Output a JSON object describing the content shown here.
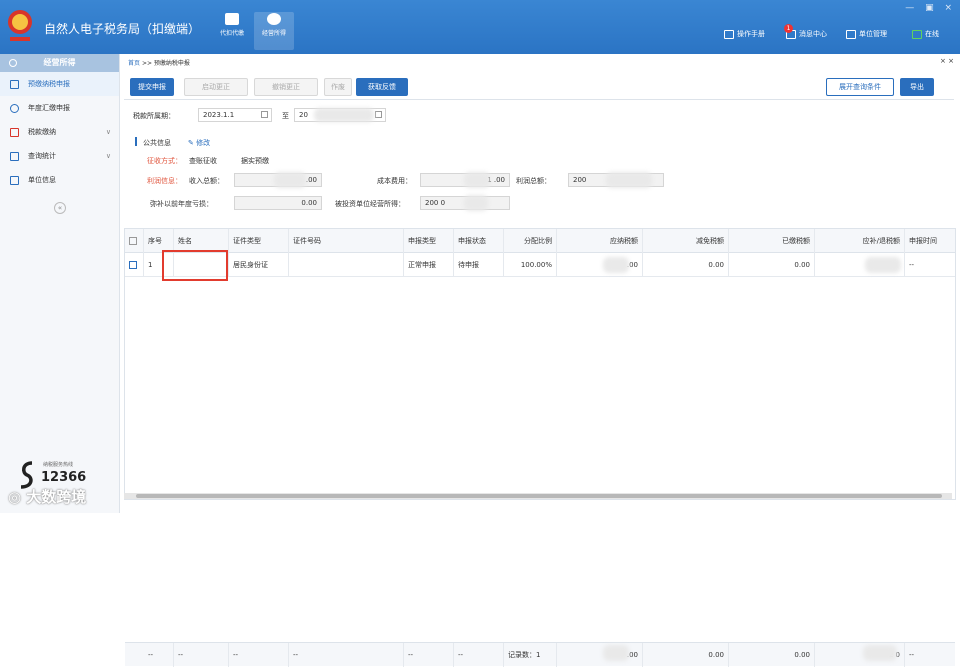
{
  "window": {
    "title": "自然人电子税务局（扣缴端）",
    "controls": "— ▣ ×"
  },
  "top_nav": [
    {
      "label": "代扣代缴",
      "icon": "wallet-icon"
    },
    {
      "label": "经营所得",
      "icon": "coins-icon"
    }
  ],
  "top_right": {
    "manual": "操作手册",
    "messages": "消息中心",
    "message_count": "1",
    "unit_mgmt": "单位管理",
    "online": "在线"
  },
  "sidebar": {
    "header": "经营所得",
    "items": [
      {
        "label": "预缴纳税申报",
        "active": true
      },
      {
        "label": "年度汇缴申报"
      },
      {
        "label": "税款缴纳",
        "chevron": "∨"
      },
      {
        "label": "查询统计",
        "chevron": "∨"
      },
      {
        "label": "单位信息"
      }
    ],
    "collapse": "«",
    "hotline_label": "纳税服务热线",
    "hotline_number": "12366",
    "watermark": "◎ 大数跨境"
  },
  "breadcrumb": {
    "home": "首页",
    "separator": ">>",
    "current": "预缴纳税申报",
    "close": "× ×"
  },
  "toolbar": {
    "submit": "提交申报",
    "start_correction": "启动更正",
    "cancel_correction": "撤销更正",
    "void": "作废",
    "get_feedback": "获取反馈",
    "expand_query": "展开查询条件",
    "export": "导出"
  },
  "period": {
    "label": "税款所属期：",
    "start": "2023.1.1",
    "to": "至",
    "end": "20"
  },
  "public_info": {
    "title": "公共信息",
    "edit": "修改",
    "collection_label": "征收方式：",
    "collection_value": "查账征收",
    "collection_value2": "据实预缴",
    "profit_label": "利润信息：",
    "income_label": "收入总额：",
    "income_value": ".00",
    "cost_label": "成本费用：",
    "cost_value": "1      .00",
    "profit_total_label": "利润总额：",
    "profit_total_value": "200",
    "loss_label": "弥补以前年度亏损：",
    "loss_value": "0.00",
    "invested_label": "被投资单位经营所得：",
    "invested_value": "200        0"
  },
  "table": {
    "columns": [
      "序号",
      "姓名",
      "证件类型",
      "证件号码",
      "申报类型",
      "申报状态",
      "分配比例",
      "应纳税额",
      "减免税额",
      "已缴税额",
      "应补/退税额",
      "申报时间"
    ],
    "rows": [
      {
        "no": "1",
        "name": "",
        "id_type": "居民身份证",
        "id_number": "",
        "report_type": "正常申报",
        "status": "待申报",
        "ratio": "100.00%",
        "tax_payable": ".00",
        "tax_relief": "0.00",
        "tax_paid": "0.00",
        "refund": "",
        "time": "--"
      }
    ],
    "footer": {
      "c1": "--",
      "c2": "--",
      "c3": "--",
      "c4": "--",
      "c5": "--",
      "c6": "--",
      "record_count": "记录数：1",
      "tax_payable": ".00",
      "tax_relief": "0.00",
      "tax_paid": "0.00",
      "refund": "2        0",
      "time": "--"
    }
  }
}
